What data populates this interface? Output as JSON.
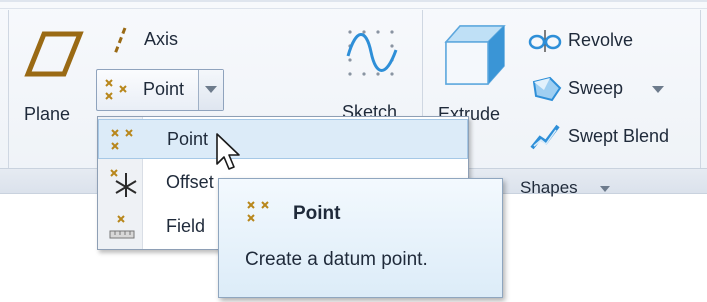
{
  "ribbon": {
    "plane_label": "Plane",
    "axis_label": "Axis",
    "point_label": "Point",
    "sketch_label": "Sketch",
    "extrude_label": "Extrude",
    "revolve_label": "Revolve",
    "sweep_label": "Sweep",
    "swept_blend_label": "Swept Blend",
    "shapes_group_label": "Shapes"
  },
  "dropdown": {
    "items": [
      {
        "label": "Point",
        "icon": "point-icon"
      },
      {
        "label": "Offset",
        "icon": "offset-coordinate-point-icon"
      },
      {
        "label": "Field",
        "icon": "field-point-icon"
      }
    ]
  },
  "tooltip": {
    "title": "Point",
    "description": "Create a datum point."
  },
  "colors": {
    "accent_blue": "#2e8fd8",
    "gold": "#b8871c",
    "highlight": "#dcebf8"
  }
}
